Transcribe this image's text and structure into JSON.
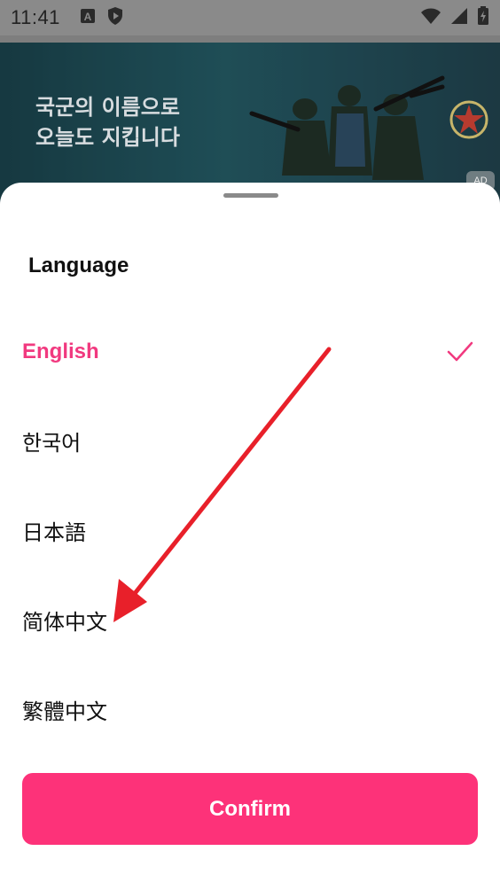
{
  "status_bar": {
    "time": "11:41",
    "left_icons": [
      "a-box-icon",
      "shield-play-icon"
    ],
    "right_icons": [
      "wifi-icon",
      "signal-icon",
      "battery-charging-icon"
    ]
  },
  "ad": {
    "headline_line1": "국군의 이름으로",
    "headline_line2": "오늘도 지킵니다",
    "badge": "AD",
    "emblem": "military-emblem-icon"
  },
  "sheet": {
    "title": "Language",
    "languages": [
      {
        "label": "English",
        "selected": true
      },
      {
        "label": "한국어",
        "selected": false
      },
      {
        "label": "日本語",
        "selected": false
      },
      {
        "label": "简体中文",
        "selected": false
      },
      {
        "label": "繁體中文",
        "selected": false
      }
    ],
    "confirm_label": "Confirm"
  },
  "colors": {
    "accent": "#fd3279",
    "selected_text": "#f1397f",
    "annotation_arrow": "#e8202a"
  }
}
